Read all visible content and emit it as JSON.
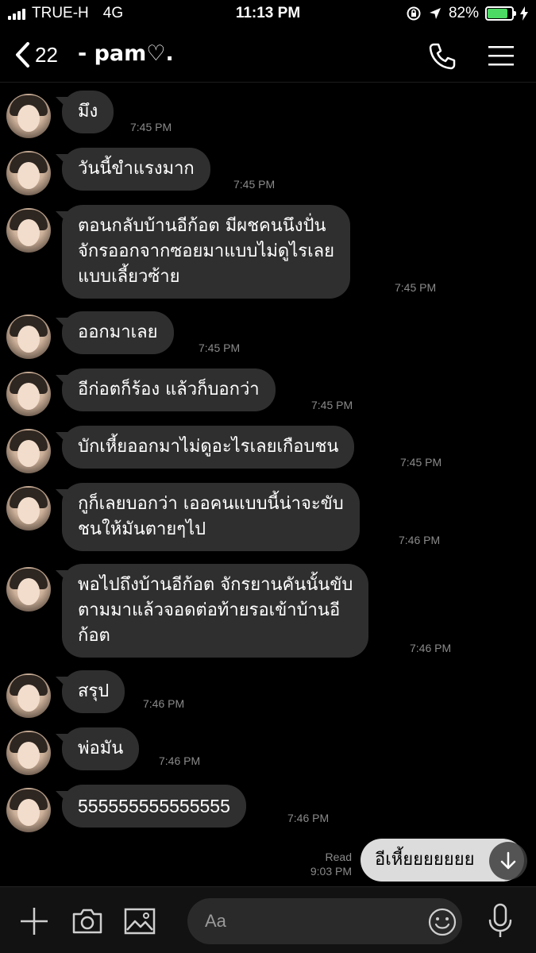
{
  "status_bar": {
    "carrier": "TRUE-H",
    "network": "4G",
    "time": "11:13 PM",
    "battery": "82%",
    "battery_level": 0.82,
    "battery_color": "#4cd964"
  },
  "header": {
    "back_count": "22",
    "title": "- pam♡.",
    "icons": [
      "chevron-left-icon",
      "phone-icon",
      "hamburger-menu-icon"
    ]
  },
  "messages": [
    {
      "text": "มึง",
      "time": "7:45 PM"
    },
    {
      "text": "วันนี้ขำแรงมาก",
      "time": "7:45 PM"
    },
    {
      "text": "ตอนกลับบ้านอีก้อต มีผชคนนึงปั่น\nจักรออกจากซอยมาแบบไม่ดูไรเลย\nแบบเลี้ยวซ้าย",
      "time": "7:45 PM"
    },
    {
      "text": "ออกมาเลย",
      "time": "7:45 PM"
    },
    {
      "text": "อีก่อตก็ร้อง แล้วก็บอกว่า",
      "time": "7:45 PM"
    },
    {
      "text": "บักเหี้ยออกมาไม่ดูอะไรเลยเกือบชน",
      "time": "7:45 PM"
    },
    {
      "text": "กูก็เลยบอกว่า เออคนแบบนี้น่าจะขับ\nชนให้มันตายๆไป",
      "time": "7:46 PM"
    },
    {
      "text": "พอไปถึงบ้านอีก้อต จักรยานคันนั้นขับ\nตามมาแล้วจอดต่อท้ายรอเข้าบ้านอี\nก้อต",
      "time": "7:46 PM"
    },
    {
      "text": "สรุป",
      "time": "7:46 PM"
    },
    {
      "text": "พ่อมัน",
      "time": "7:46 PM"
    },
    {
      "text": "555555555555555",
      "time": "7:46 PM"
    }
  ],
  "outgoing": {
    "text": "อีเหี้ยยยยยยย",
    "read_label": "Read",
    "time": "9:03 PM"
  },
  "input": {
    "placeholder": "Aa"
  },
  "colors": {
    "background": "#000000",
    "incoming_bubble": "#2f2f2f",
    "outgoing_bubble": "#dcdcdc"
  }
}
